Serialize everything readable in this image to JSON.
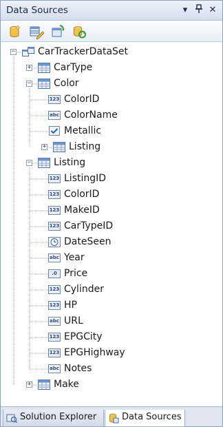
{
  "panel": {
    "title": "Data Sources",
    "dropdown_glyph": "▾",
    "pin_glyph": "ᵽ",
    "close_glyph": "✕"
  },
  "toolbar": {
    "buttons": [
      {
        "name": "add-new-data-source-button",
        "icon": "database-add-icon"
      },
      {
        "name": "edit-dataset-designer-button",
        "icon": "dataset-edit-icon"
      },
      {
        "name": "configure-dataset-wizard-button",
        "icon": "configure-wizard-icon"
      },
      {
        "name": "refresh-button",
        "icon": "refresh-icon"
      }
    ]
  },
  "tree": {
    "root": {
      "label": "CarTrackerDataSet",
      "icon": "dataset-icon",
      "expanded": true
    },
    "nodes": [
      {
        "label": "CarType",
        "kind": "table",
        "level": 1,
        "expander": "+"
      },
      {
        "label": "Color",
        "kind": "table",
        "level": 1,
        "expander": "−"
      },
      {
        "label": "ColorID",
        "kind": "123",
        "level": 2
      },
      {
        "label": "ColorName",
        "kind": "abc",
        "level": 2
      },
      {
        "label": "Metallic",
        "kind": "check",
        "level": 2
      },
      {
        "label": "Listing",
        "kind": "table",
        "level": 2,
        "expander": "+"
      },
      {
        "label": "Listing",
        "kind": "table",
        "level": 1,
        "expander": "−"
      },
      {
        "label": "ListingID",
        "kind": "123",
        "level": 2
      },
      {
        "label": "ColorID",
        "kind": "123",
        "level": 2
      },
      {
        "label": "MakeID",
        "kind": "123",
        "level": 2
      },
      {
        "label": "CarTypeID",
        "kind": "123",
        "level": 2
      },
      {
        "label": "DateSeen",
        "kind": "date",
        "level": 2
      },
      {
        "label": "Year",
        "kind": "abc",
        "level": 2
      },
      {
        "label": "Price",
        "kind": "dec",
        "level": 2
      },
      {
        "label": "Cylinder",
        "kind": "123",
        "level": 2
      },
      {
        "label": "HP",
        "kind": "123",
        "level": 2
      },
      {
        "label": "URL",
        "kind": "abc",
        "level": 2
      },
      {
        "label": "EPGCity",
        "kind": "123",
        "level": 2
      },
      {
        "label": "EPGHighway",
        "kind": "123",
        "level": 2
      },
      {
        "label": "Notes",
        "kind": "abc",
        "level": 2
      },
      {
        "label": "Make",
        "kind": "table",
        "level": 1,
        "expander": "+"
      }
    ],
    "badges": {
      "123": "123",
      "abc": "abc",
      "dec": ".0"
    }
  },
  "tabs": [
    {
      "label": "Solution Explorer",
      "icon": "solution-explorer-icon",
      "active": false
    },
    {
      "label": "Data Sources",
      "icon": "data-sources-icon",
      "active": true
    }
  ],
  "colors": {
    "accent": "#3a6fb5",
    "table_header": "#6d93c8",
    "titlebar": "#d4deec"
  }
}
